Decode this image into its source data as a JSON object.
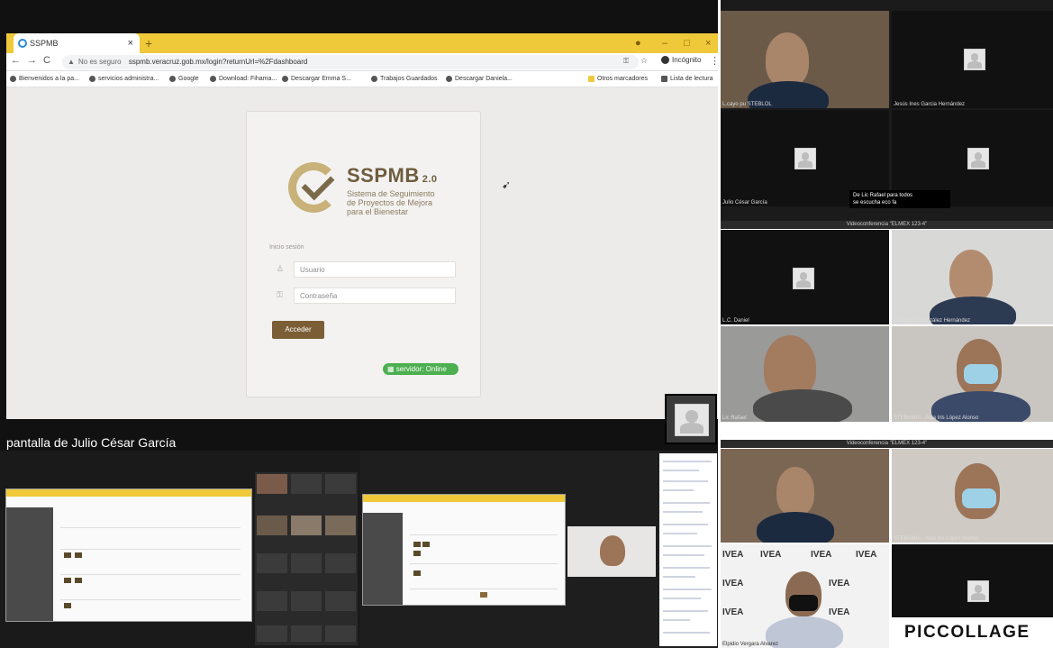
{
  "browser": {
    "tab_title": "SSPMB",
    "new_tab": "+",
    "not_secure": "No es seguro",
    "url": "sspmb.veracruz.gob.mx/login?returnUrl=%2Fdashboard",
    "incognito": "Incógnito",
    "bookmarks": [
      "Bienvenidos a la pa...",
      "servicios administra...",
      "Google",
      "Download: Fihama...",
      "Descargar Emma S...",
      "Trabajos Guardados",
      "Descargar Daniela...",
      "Otros marcadores",
      "Lista de lectura"
    ]
  },
  "login": {
    "brand": "SSPMB",
    "version": "2.0",
    "subtitle_1": "Sistema de Seguimiento",
    "subtitle_2": "de Proyectos de Mejora",
    "subtitle_3": "para el Bienestar",
    "section_label": "Inicio sesión",
    "username_placeholder": "Usuario",
    "password_placeholder": "Contraseña",
    "submit_label": "Acceder",
    "server_status": "servidor: Online"
  },
  "meeting": {
    "share_caption": "pantalla de Julio César García",
    "conference_title": "Videoconferencia \"ELMEX 123-4\"",
    "chat_notice_1": "De Lic Rafael para todos",
    "chat_notice_2": "se escucha eco fa",
    "participants": [
      {
        "name": "L.cayo pu STEBLOL"
      },
      {
        "name": "Jesús Ines Garcia Hernández"
      },
      {
        "name": "Julio César García"
      },
      {
        "name": "L.C. Daniel"
      },
      {
        "name": "Luis Hugo González Hernández"
      },
      {
        "name": "Lic Rafael"
      },
      {
        "name": "STEBAMIA - Alba Iris López Alonso"
      },
      {
        "name": "STEBAMIA - Alba Iris López Alonso"
      },
      {
        "name": "Elpidio Vergara Alvarez"
      }
    ],
    "watermark_word": "IVEA",
    "collage_brand": "PICCOLLAGE"
  }
}
